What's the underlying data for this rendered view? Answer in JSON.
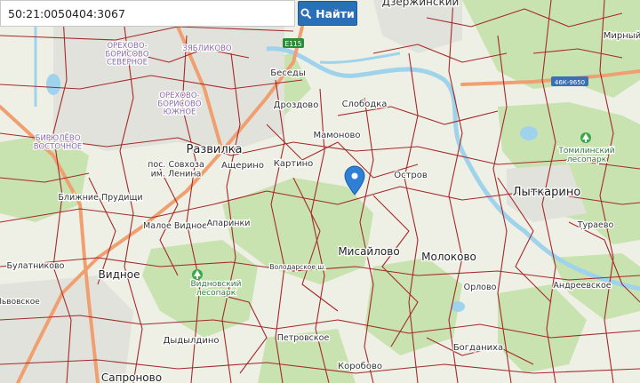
{
  "search": {
    "value": "50:21:0050404:3067",
    "button_label": "Найти",
    "button_icon": "search-icon"
  },
  "map": {
    "colors": {
      "background": "#eef0e6",
      "forest": "#c8e3b0",
      "water": "#9fd3ec",
      "parcel_border": "#a52a2a",
      "highway": "#f0a070",
      "marker": "#2f7fd6",
      "park_icon": "#3aa84a"
    },
    "labels": {
      "orekhovo_north": "ОРЕХОВО-\nБОРИСОВО\nСЕВЕРНОЕ",
      "zyablikovo": "ЗЯБЛИКОВО",
      "orekhovo_south": "ОРЕХОВО-\nБОРИСОВО\nЮЖНОЕ",
      "biryulyovo": "БИРЮЛЁВО\nВОСТОЧНОЕ",
      "dzerzhinsky": "Дзержинский",
      "mirny": "Мирный",
      "besedy": "Беседы",
      "drozdovo": "Дроздово",
      "slobodka": "Слободка",
      "mamonovo": "Мамоново",
      "razvilka": "Развилка",
      "asherino": "Ащерино",
      "kartino": "Картино",
      "ostrov": "Остров",
      "lytkarino": "Лыткарино",
      "tomilinsky": "Томилинский\nлесопарк",
      "posolok": "пос. Совхоза\nим. Ленина",
      "bliznie": "Ближние Прудищи",
      "maloe_vidnoe": "Малое Видное",
      "apariki": "Апаринки",
      "misailovo": "Мисайлово",
      "molokovo": "Молоково",
      "turaevo": "Тураево",
      "bulatnikovo": "Булатниково",
      "vidnoe": "Видное",
      "vidnovsky": "Видновский\nлесопарк",
      "volodarskoe": "Володарское ш.",
      "orlovo": "Орлово",
      "andreevskoe": "Андреевское",
      "lvovsky": "Львовское",
      "dydyldino": "Дыдылдино",
      "petrovskoe": "Петровское",
      "bogdanikha": "Богданиха",
      "sapronovo": "Сапроново",
      "korobovo": "Коробово",
      "road_e115": "Е115",
      "road_46k": "46К-9650"
    }
  }
}
